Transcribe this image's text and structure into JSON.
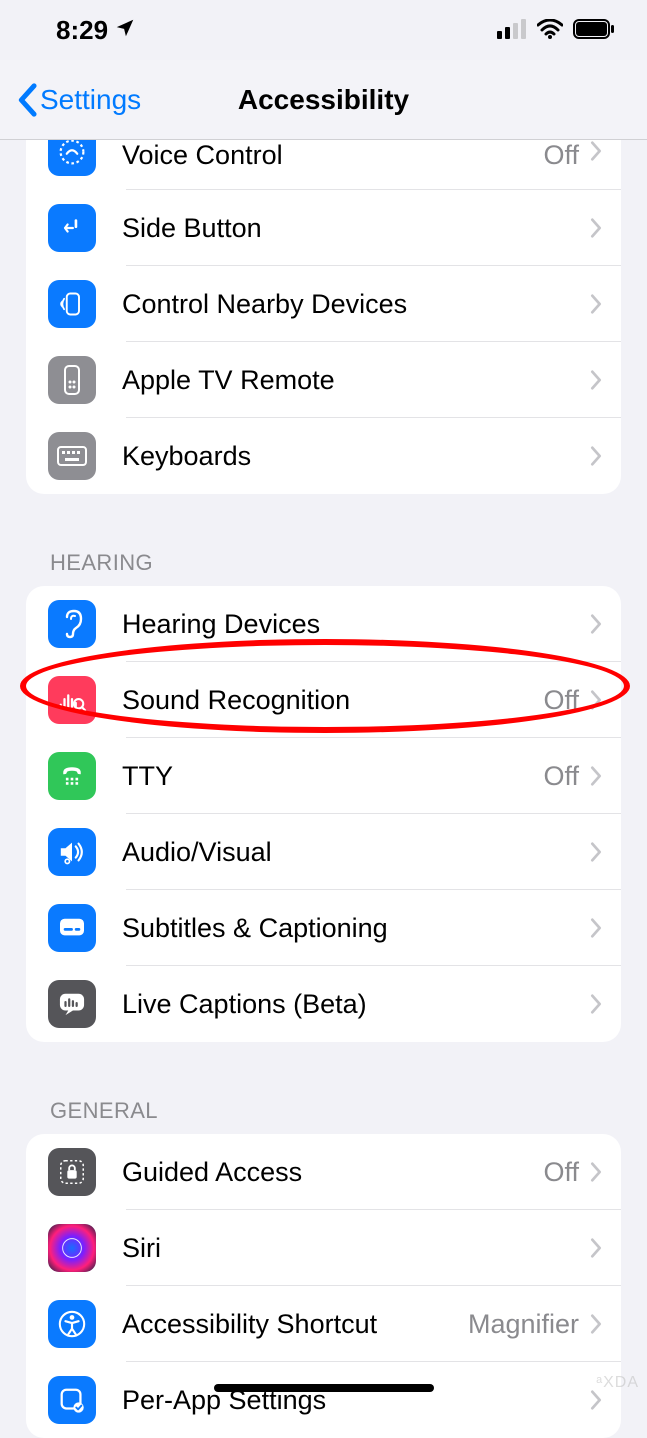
{
  "status": {
    "time": "8:29"
  },
  "nav": {
    "back": "Settings",
    "title": "Accessibility"
  },
  "sections": {
    "physical": {
      "items": [
        {
          "label": "Voice Control",
          "value": "Off",
          "icon": "voice-control-icon",
          "color": "ic-blue"
        },
        {
          "label": "Side Button",
          "value": "",
          "icon": "side-button-icon",
          "color": "ic-blue"
        },
        {
          "label": "Control Nearby Devices",
          "value": "",
          "icon": "nearby-devices-icon",
          "color": "ic-blue"
        },
        {
          "label": "Apple TV Remote",
          "value": "",
          "icon": "appletv-remote-icon",
          "color": "ic-gray"
        },
        {
          "label": "Keyboards",
          "value": "",
          "icon": "keyboard-icon",
          "color": "ic-gray"
        }
      ]
    },
    "hearing": {
      "header": "HEARING",
      "items": [
        {
          "label": "Hearing Devices",
          "value": "",
          "icon": "ear-icon",
          "color": "ic-blue"
        },
        {
          "label": "Sound Recognition",
          "value": "Off",
          "icon": "sound-recognition-icon",
          "color": "ic-red",
          "highlighted": true
        },
        {
          "label": "TTY",
          "value": "Off",
          "icon": "tty-icon",
          "color": "ic-green"
        },
        {
          "label": "Audio/Visual",
          "value": "",
          "icon": "audio-visual-icon",
          "color": "ic-blue"
        },
        {
          "label": "Subtitles & Captioning",
          "value": "",
          "icon": "subtitles-icon",
          "color": "ic-blue"
        },
        {
          "label": "Live Captions (Beta)",
          "value": "",
          "icon": "live-captions-icon",
          "color": "ic-darkgray"
        }
      ]
    },
    "general": {
      "header": "GENERAL",
      "items": [
        {
          "label": "Guided Access",
          "value": "Off",
          "icon": "guided-access-icon",
          "color": "ic-darkgray"
        },
        {
          "label": "Siri",
          "value": "",
          "icon": "siri-icon",
          "color": "ic-siri"
        },
        {
          "label": "Accessibility Shortcut",
          "value": "Magnifier",
          "icon": "accessibility-shortcut-icon",
          "color": "ic-blue"
        },
        {
          "label": "Per-App Settings",
          "value": "",
          "icon": "per-app-settings-icon",
          "color": "ic-blue"
        }
      ]
    }
  },
  "watermark": "ᵃXDA"
}
